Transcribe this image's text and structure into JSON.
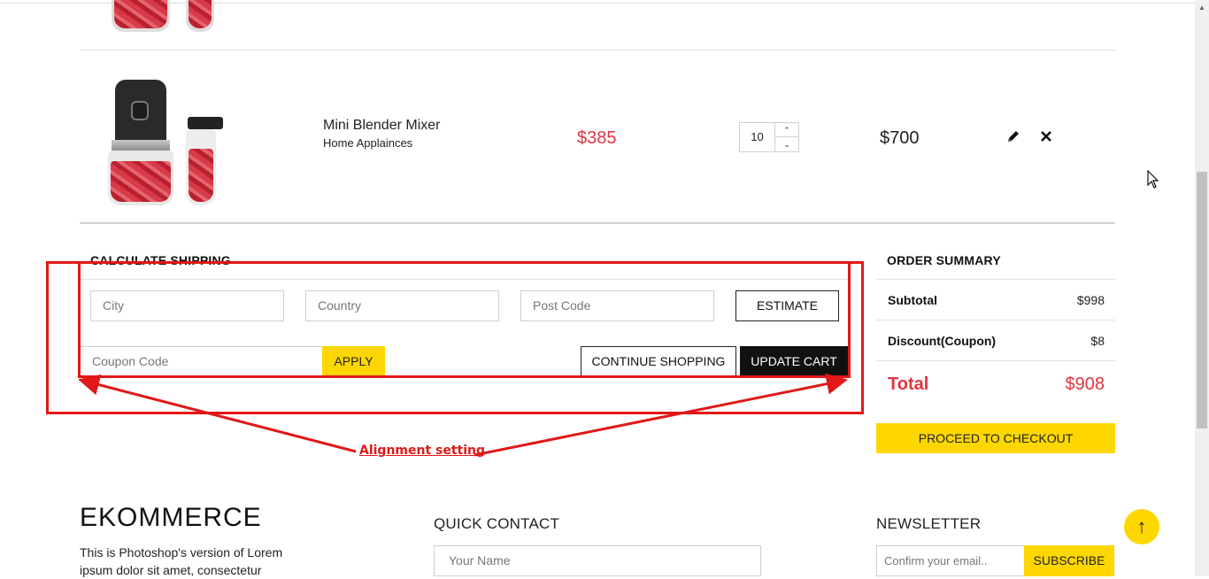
{
  "cart": {
    "item": {
      "name": "Mini Blender Mixer",
      "category": "Home Applainces",
      "price": "$385",
      "quantity": "10",
      "total": "$700"
    }
  },
  "shipping": {
    "title": "CALCULATE SHIPPING",
    "city_placeholder": "City",
    "country_placeholder": "Country",
    "postcode_placeholder": "Post Code",
    "estimate_label": "ESTIMATE",
    "coupon_placeholder": "Coupon Code",
    "apply_label": "APPLY",
    "continue_label": "CONTINUE SHOPPING",
    "update_label": "UPDATE CART"
  },
  "summary": {
    "title": "ORDER SUMMARY",
    "subtotal_label": "Subtotal",
    "subtotal_value": "$998",
    "discount_label": "Discount(Coupon)",
    "discount_value": "$8",
    "total_label": "Total",
    "total_value": "$908",
    "checkout_label": "PROCEED TO CHECKOUT"
  },
  "annotation": {
    "text": "Alignment setting",
    "color": "#e01818"
  },
  "footer": {
    "logo": "EKOMMERCE",
    "about": "This is Photoshop's version of Lorem ipsum dolor sit amet, consectetur",
    "contact_title": "QUICK CONTACT",
    "name_placeholder": "Your Name",
    "newsletter_title": "NEWSLETTER",
    "email_placeholder": "Confirm your email..",
    "subscribe_label": "SUBSCRIBE"
  },
  "colors": {
    "accent_yellow": "#fed700",
    "price_red": "#e0343f"
  },
  "icons": {
    "edit": "pencil-icon",
    "remove": "close-icon",
    "back_to_top": "arrow-up-icon"
  }
}
